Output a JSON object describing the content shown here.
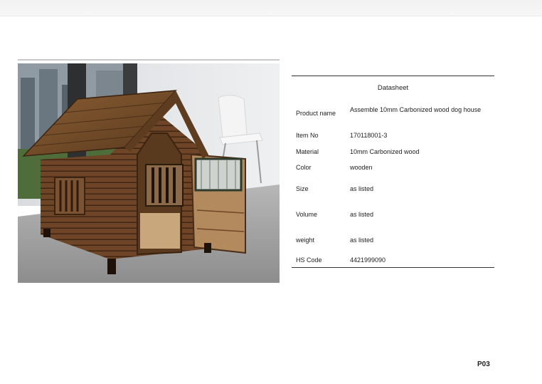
{
  "datasheet": {
    "title": "Datasheet",
    "rows": [
      {
        "label": "Product name",
        "value": "Assemble 10mm Carbonized wood dog house"
      },
      {
        "label": "Item No",
        "value": "170118001-3"
      },
      {
        "label": "Material",
        "value": "10mm Carbonized wood"
      },
      {
        "label": "Color",
        "value": "wooden"
      },
      {
        "label": "Size",
        "value": "as listed"
      },
      {
        "label": "Volume",
        "value": "as listed"
      },
      {
        "label": "weight",
        "value": "as listed"
      },
      {
        "label": "HS Code",
        "value": "4421999090"
      }
    ]
  },
  "page": {
    "number": "P03"
  },
  "colors": {
    "rule": "#333333",
    "wood": "#7a4f2c",
    "wood_dark": "#4a2e18",
    "floor": "#9a9a9a"
  }
}
